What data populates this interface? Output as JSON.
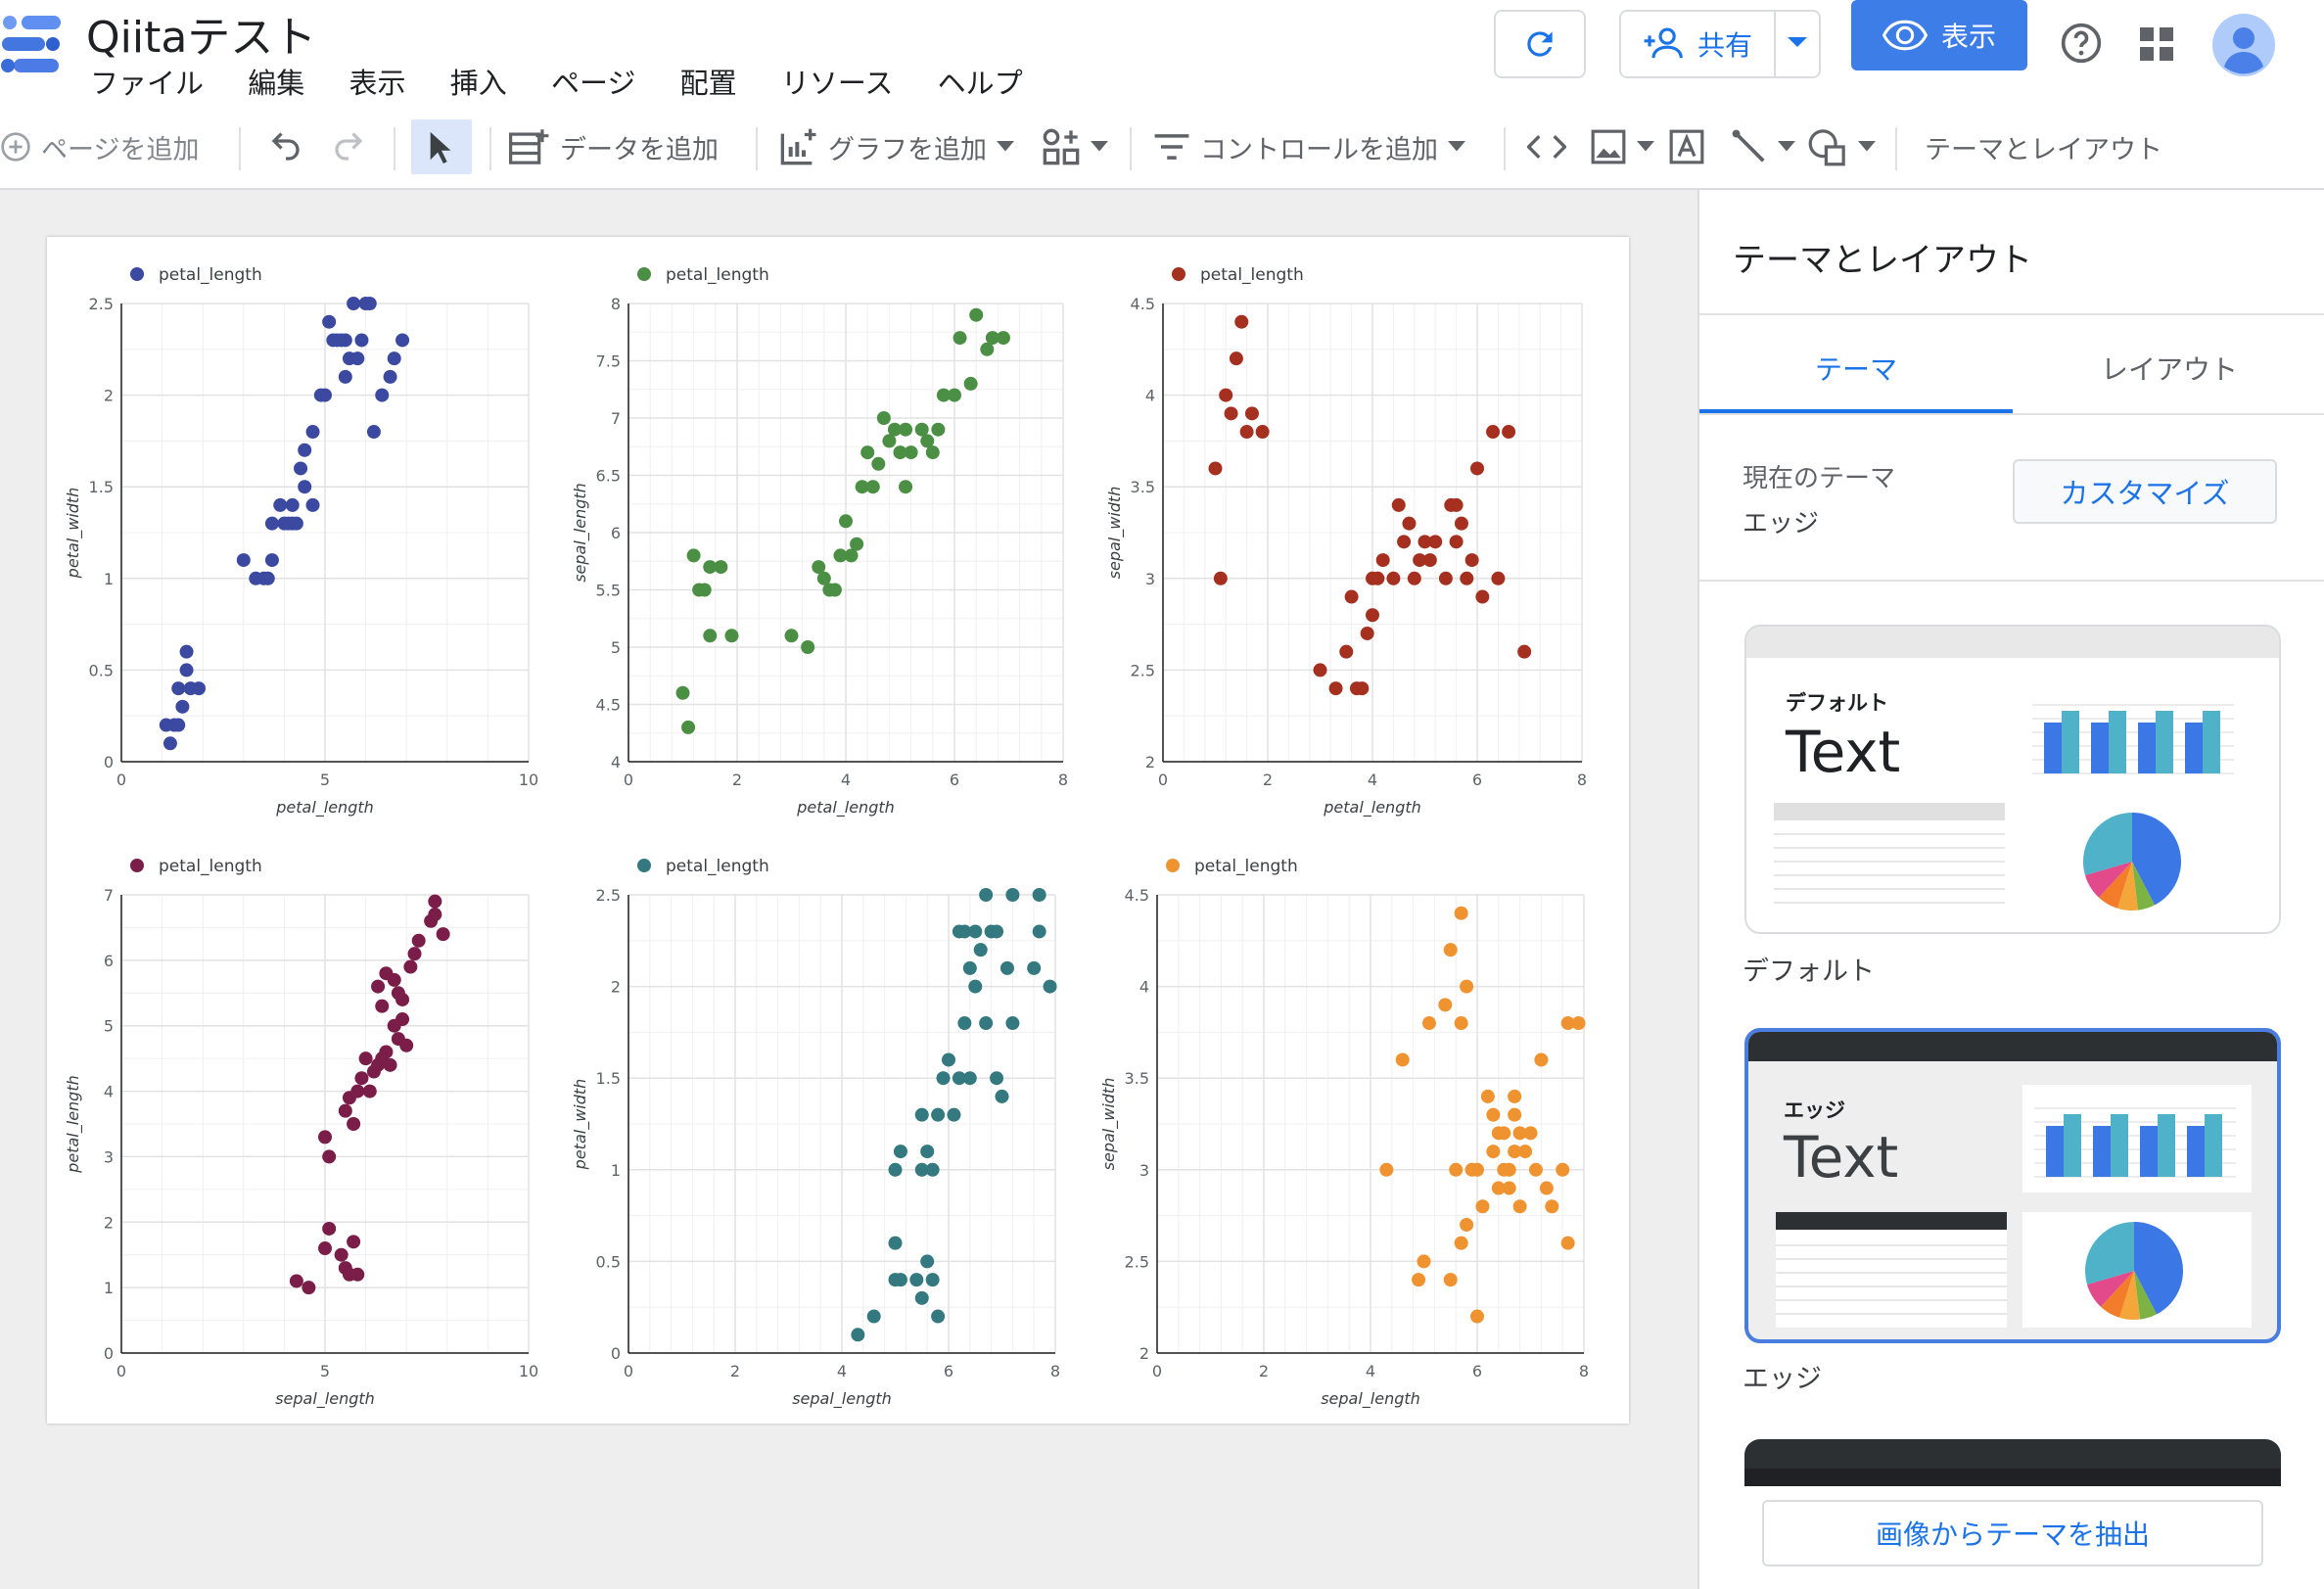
{
  "app": {
    "doc_title": "Qiitaテスト",
    "menus": [
      "ファイル",
      "編集",
      "表示",
      "挿入",
      "ページ",
      "配置",
      "リソース",
      "ヘルプ"
    ],
    "share_label": "共有",
    "view_label": "表示"
  },
  "toolbar": {
    "add_page": "ページを追加",
    "add_data": "データを追加",
    "add_chart": "グラフを追加",
    "add_control": "コントロールを追加",
    "theme_layout": "テーマとレイアウト"
  },
  "panel": {
    "title": "テーマとレイアウト",
    "tab_theme": "テーマ",
    "tab_layout": "レイアウト",
    "current_theme_label": "現在のテーマ",
    "current_theme_value": "エッジ",
    "customize_label": "カスタマイズ",
    "themes": [
      {
        "name": "デフォルト",
        "preview_label": "デフォルト",
        "preview_text": "Text"
      },
      {
        "name": "エッジ",
        "preview_label": "エッジ",
        "preview_text": "Text"
      }
    ],
    "extract_label": "画像からテーマを抽出"
  },
  "colors": {
    "accent": "#1a73e8",
    "primary_button": "#3d7de8",
    "series": [
      "#3b4aa0",
      "#4b8f45",
      "#a6301f",
      "#7a1d48",
      "#33797f",
      "#ef9330"
    ]
  },
  "chart_data": [
    {
      "type": "scatter",
      "legend": "petal_length",
      "color": "#3b4aa0",
      "xlabel": "petal_length",
      "ylabel": "petal_width",
      "xlim": [
        0,
        10
      ],
      "ylim": [
        0,
        2.5
      ],
      "xticks": [
        0,
        5,
        10
      ],
      "yticks": [
        0,
        0.5,
        1,
        1.5,
        2,
        2.5
      ],
      "points": [
        [
          1.1,
          0.2
        ],
        [
          1.3,
          0.2
        ],
        [
          1.4,
          0.2
        ],
        [
          1.2,
          0.1
        ],
        [
          1.5,
          0.3
        ],
        [
          1.4,
          0.4
        ],
        [
          1.7,
          0.4
        ],
        [
          1.6,
          0.6
        ],
        [
          1.9,
          0.4
        ],
        [
          1.6,
          0.5
        ],
        [
          3,
          1.1
        ],
        [
          3.3,
          1
        ],
        [
          3.5,
          1
        ],
        [
          3.6,
          1
        ],
        [
          3.7,
          1.1
        ],
        [
          3.7,
          1.3
        ],
        [
          3.9,
          1.4
        ],
        [
          4,
          1.3
        ],
        [
          4.1,
          1.3
        ],
        [
          4.2,
          1.3
        ],
        [
          4.3,
          1.3
        ],
        [
          4.5,
          1.5
        ],
        [
          4.2,
          1.4
        ],
        [
          4.7,
          1.4
        ],
        [
          4.4,
          1.6
        ],
        [
          4.5,
          1.7
        ],
        [
          4.7,
          1.8
        ],
        [
          4.9,
          2
        ],
        [
          5,
          2
        ],
        [
          5.1,
          2.4
        ],
        [
          5.3,
          2.3
        ],
        [
          5.4,
          2.3
        ],
        [
          5.5,
          2.3
        ],
        [
          5.6,
          2.2
        ],
        [
          5.7,
          2.5
        ],
        [
          5.9,
          2.3
        ],
        [
          6,
          2.5
        ],
        [
          6.1,
          2.5
        ],
        [
          5.8,
          2.2
        ],
        [
          6.2,
          1.8
        ],
        [
          6.4,
          2
        ],
        [
          6.6,
          2.1
        ],
        [
          6.7,
          2.2
        ],
        [
          6.9,
          2.3
        ],
        [
          5.5,
          2.1
        ],
        [
          5.2,
          2.3
        ]
      ]
    },
    {
      "type": "scatter",
      "legend": "petal_length",
      "color": "#4b8f45",
      "xlabel": "petal_length",
      "ylabel": "sepal_length",
      "xlim": [
        0,
        8
      ],
      "ylim": [
        4,
        8
      ],
      "xticks": [
        0,
        2,
        4,
        6,
        8
      ],
      "yticks": [
        4,
        4.5,
        5,
        5.5,
        6,
        6.5,
        7,
        7.5,
        8
      ],
      "points": [
        [
          1,
          4.6
        ],
        [
          1.1,
          4.3
        ],
        [
          1.2,
          5.8
        ],
        [
          1.3,
          5.5
        ],
        [
          1.4,
          5.5
        ],
        [
          1.5,
          5.1
        ],
        [
          1.5,
          5.7
        ],
        [
          1.7,
          5.7
        ],
        [
          1.9,
          5.1
        ],
        [
          3,
          5.1
        ],
        [
          3.3,
          5
        ],
        [
          3.5,
          5.7
        ],
        [
          3.6,
          5.6
        ],
        [
          3.7,
          5.5
        ],
        [
          3.8,
          5.5
        ],
        [
          3.9,
          5.8
        ],
        [
          4,
          6.1
        ],
        [
          4.1,
          5.8
        ],
        [
          4.2,
          5.9
        ],
        [
          4.3,
          6.4
        ],
        [
          4.4,
          6.7
        ],
        [
          4.5,
          6.4
        ],
        [
          4.6,
          6.6
        ],
        [
          4.7,
          7
        ],
        [
          4.8,
          6.8
        ],
        [
          4.9,
          6.9
        ],
        [
          5,
          6.7
        ],
        [
          5.1,
          6.9
        ],
        [
          5.2,
          6.7
        ],
        [
          5.4,
          6.9
        ],
        [
          5.1,
          6.4
        ],
        [
          5.5,
          6.8
        ],
        [
          5.6,
          6.7
        ],
        [
          5.7,
          6.9
        ],
        [
          5.8,
          7.2
        ],
        [
          6,
          7.2
        ],
        [
          6.1,
          7.7
        ],
        [
          6.3,
          7.3
        ],
        [
          6.4,
          7.9
        ],
        [
          6.6,
          7.6
        ],
        [
          6.7,
          7.7
        ],
        [
          6.9,
          7.7
        ]
      ]
    },
    {
      "type": "scatter",
      "legend": "petal_length",
      "color": "#a6301f",
      "xlabel": "petal_length",
      "ylabel": "sepal_width",
      "xlim": [
        0,
        8
      ],
      "ylim": [
        2,
        4.5
      ],
      "xticks": [
        0,
        2,
        4,
        6,
        8
      ],
      "yticks": [
        2,
        2.5,
        3,
        3.5,
        4,
        4.5
      ],
      "points": [
        [
          1,
          3.6
        ],
        [
          1.1,
          3
        ],
        [
          1.2,
          4
        ],
        [
          1.3,
          3.9
        ],
        [
          1.4,
          4.2
        ],
        [
          1.5,
          4.4
        ],
        [
          1.6,
          3.8
        ],
        [
          1.7,
          3.9
        ],
        [
          1.9,
          3.8
        ],
        [
          3,
          2.5
        ],
        [
          3.3,
          2.4
        ],
        [
          3.5,
          2.6
        ],
        [
          3.6,
          2.9
        ],
        [
          3.7,
          2.4
        ],
        [
          3.8,
          2.4
        ],
        [
          3.9,
          2.7
        ],
        [
          4,
          2.8
        ],
        [
          4,
          3
        ],
        [
          4.1,
          3
        ],
        [
          4.2,
          3.1
        ],
        [
          4.4,
          3
        ],
        [
          4.5,
          3.4
        ],
        [
          4.6,
          3.2
        ],
        [
          4.7,
          3.3
        ],
        [
          4.8,
          3
        ],
        [
          4.9,
          3.1
        ],
        [
          5,
          3.2
        ],
        [
          5.1,
          3.1
        ],
        [
          5.2,
          3.2
        ],
        [
          5.4,
          3
        ],
        [
          5.5,
          3.4
        ],
        [
          5.6,
          3.4
        ],
        [
          5.7,
          3.3
        ],
        [
          5.8,
          3
        ],
        [
          5.9,
          3.1
        ],
        [
          6,
          3.6
        ],
        [
          6.1,
          2.9
        ],
        [
          6.3,
          3.8
        ],
        [
          6.4,
          3
        ],
        [
          6.6,
          3.8
        ],
        [
          6.9,
          2.6
        ],
        [
          5.6,
          3.2
        ]
      ]
    },
    {
      "type": "scatter",
      "legend": "petal_length",
      "color": "#7a1d48",
      "xlabel": "sepal_length",
      "ylabel": "petal_length",
      "xlim": [
        0,
        10
      ],
      "ylim": [
        0,
        7
      ],
      "xticks": [
        0,
        5,
        10
      ],
      "yticks": [
        0,
        1,
        2,
        3,
        4,
        5,
        6,
        7
      ],
      "points": [
        [
          4.3,
          1.1
        ],
        [
          4.6,
          1
        ],
        [
          5,
          1.6
        ],
        [
          5,
          3.3
        ],
        [
          5.1,
          1.9
        ],
        [
          5.1,
          3
        ],
        [
          5.4,
          1.5
        ],
        [
          5.5,
          1.3
        ],
        [
          5.6,
          1.2
        ],
        [
          5.7,
          1.7
        ],
        [
          5.8,
          1.2
        ],
        [
          5.5,
          3.7
        ],
        [
          5.6,
          3.9
        ],
        [
          5.7,
          3.5
        ],
        [
          5.8,
          4
        ],
        [
          5.9,
          4.2
        ],
        [
          6,
          4.5
        ],
        [
          6.1,
          4
        ],
        [
          6.2,
          4.3
        ],
        [
          6.3,
          4.4
        ],
        [
          6.4,
          4.5
        ],
        [
          6.4,
          5.3
        ],
        [
          6.5,
          4.6
        ],
        [
          6.6,
          4.4
        ],
        [
          6.7,
          5
        ],
        [
          6.8,
          4.8
        ],
        [
          6.9,
          5.1
        ],
        [
          7,
          4.7
        ],
        [
          6.3,
          5.6
        ],
        [
          6.5,
          5.8
        ],
        [
          6.7,
          5.7
        ],
        [
          6.9,
          5.4
        ],
        [
          6.8,
          5.5
        ],
        [
          7.1,
          5.9
        ],
        [
          7.2,
          6.1
        ],
        [
          7.3,
          6.3
        ],
        [
          7.6,
          6.6
        ],
        [
          7.7,
          6.7
        ],
        [
          7.7,
          6.9
        ],
        [
          7.9,
          6.4
        ]
      ]
    },
    {
      "type": "scatter",
      "legend": "petal_length",
      "color": "#33797f",
      "xlabel": "sepal_length",
      "ylabel": "petal_width",
      "xlim": [
        0,
        8
      ],
      "ylim": [
        0,
        2.5
      ],
      "xticks": [
        0,
        2,
        4,
        6,
        8
      ],
      "yticks": [
        0,
        0.5,
        1,
        1.5,
        2,
        2.5
      ],
      "points": [
        [
          4.3,
          0.1
        ],
        [
          4.6,
          0.2
        ],
        [
          5,
          0.4
        ],
        [
          5,
          0.6
        ],
        [
          5.1,
          0.4
        ],
        [
          5.4,
          0.4
        ],
        [
          5.5,
          0.3
        ],
        [
          5.6,
          0.5
        ],
        [
          5.7,
          0.4
        ],
        [
          5.8,
          0.2
        ],
        [
          5,
          1
        ],
        [
          5.1,
          1.1
        ],
        [
          5.5,
          1
        ],
        [
          5.6,
          1.1
        ],
        [
          5.7,
          1
        ],
        [
          5.5,
          1.3
        ],
        [
          5.8,
          1.3
        ],
        [
          5.9,
          1.5
        ],
        [
          6,
          1.6
        ],
        [
          6.1,
          1.3
        ],
        [
          6.2,
          1.5
        ],
        [
          6.3,
          1.8
        ],
        [
          6.4,
          1.5
        ],
        [
          6.5,
          2
        ],
        [
          6.7,
          1.8
        ],
        [
          6.9,
          1.5
        ],
        [
          7,
          1.4
        ],
        [
          7.2,
          1.8
        ],
        [
          6.3,
          2.3
        ],
        [
          6.4,
          2.1
        ],
        [
          6.5,
          2.3
        ],
        [
          6.7,
          2.5
        ],
        [
          6.8,
          2.3
        ],
        [
          6.9,
          2.3
        ],
        [
          7.1,
          2.1
        ],
        [
          7.2,
          2.5
        ],
        [
          7.7,
          2.3
        ],
        [
          7.7,
          2.5
        ],
        [
          7.9,
          2
        ],
        [
          7.6,
          2.1
        ],
        [
          6.2,
          2.3
        ],
        [
          6.6,
          2.2
        ]
      ]
    },
    {
      "type": "scatter",
      "legend": "petal_length",
      "color": "#ef9330",
      "xlabel": "sepal_length",
      "ylabel": "sepal_width",
      "xlim": [
        0,
        8
      ],
      "ylim": [
        2,
        4.5
      ],
      "xticks": [
        0,
        2,
        4,
        6,
        8
      ],
      "yticks": [
        2,
        2.5,
        3,
        3.5,
        4,
        4.5
      ],
      "points": [
        [
          4.3,
          3
        ],
        [
          4.6,
          3.6
        ],
        [
          4.9,
          2.4
        ],
        [
          5,
          2.5
        ],
        [
          5.1,
          3.8
        ],
        [
          5.4,
          3.9
        ],
        [
          5.5,
          4.2
        ],
        [
          5.6,
          3
        ],
        [
          5.7,
          4.4
        ],
        [
          5.7,
          3.8
        ],
        [
          5.8,
          4
        ],
        [
          5.5,
          2.4
        ],
        [
          5.7,
          2.6
        ],
        [
          5.8,
          2.7
        ],
        [
          5.9,
          3
        ],
        [
          6,
          3
        ],
        [
          6,
          2.2
        ],
        [
          6.1,
          2.8
        ],
        [
          6.2,
          3.4
        ],
        [
          6.3,
          3.3
        ],
        [
          6.4,
          2.9
        ],
        [
          6.5,
          3
        ],
        [
          6.5,
          3.2
        ],
        [
          6.6,
          3
        ],
        [
          6.7,
          3.1
        ],
        [
          6.8,
          3.2
        ],
        [
          6.9,
          3.1
        ],
        [
          7,
          3.2
        ],
        [
          6.3,
          3.1
        ],
        [
          6.4,
          3.2
        ],
        [
          6.7,
          3.3
        ],
        [
          6.8,
          2.8
        ],
        [
          7.1,
          3
        ],
        [
          7.2,
          3.6
        ],
        [
          7.3,
          2.9
        ],
        [
          7.4,
          2.8
        ],
        [
          7.6,
          3
        ],
        [
          7.7,
          3.8
        ],
        [
          7.7,
          2.6
        ],
        [
          7.9,
          3.8
        ],
        [
          6.6,
          2.9
        ],
        [
          6.7,
          3.4
        ]
      ]
    }
  ]
}
